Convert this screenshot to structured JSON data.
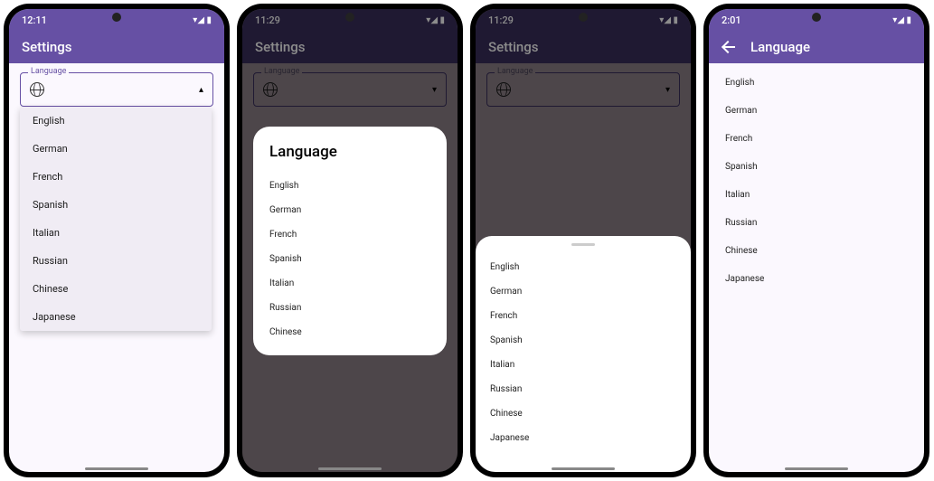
{
  "phone1": {
    "time": "12:11",
    "status_icons": "▾◢ ▮",
    "title": "Settings",
    "field_label": "Language",
    "dropdown_arrow": "▴",
    "languages": [
      "English",
      "German",
      "French",
      "Spanish",
      "Italian",
      "Russian",
      "Chinese",
      "Japanese"
    ]
  },
  "phone2": {
    "time": "11:29",
    "status_icons": "▾◢ ▮",
    "title": "Settings",
    "field_label": "Language",
    "dropdown_arrow": "▾",
    "dialog_title": "Language",
    "languages": [
      "English",
      "German",
      "French",
      "Spanish",
      "Italian",
      "Russian",
      "Chinese"
    ]
  },
  "phone3": {
    "time": "11:29",
    "status_icons": "▾◢ ▮",
    "title": "Settings",
    "field_label": "Language",
    "dropdown_arrow": "▾",
    "languages": [
      "English",
      "German",
      "French",
      "Spanish",
      "Italian",
      "Russian",
      "Chinese",
      "Japanese"
    ]
  },
  "phone4": {
    "time": "2:01",
    "status_icons": "▾◢ ▮",
    "title": "Language",
    "languages": [
      "English",
      "German",
      "French",
      "Spanish",
      "Italian",
      "Russian",
      "Chinese",
      "Japanese"
    ]
  }
}
